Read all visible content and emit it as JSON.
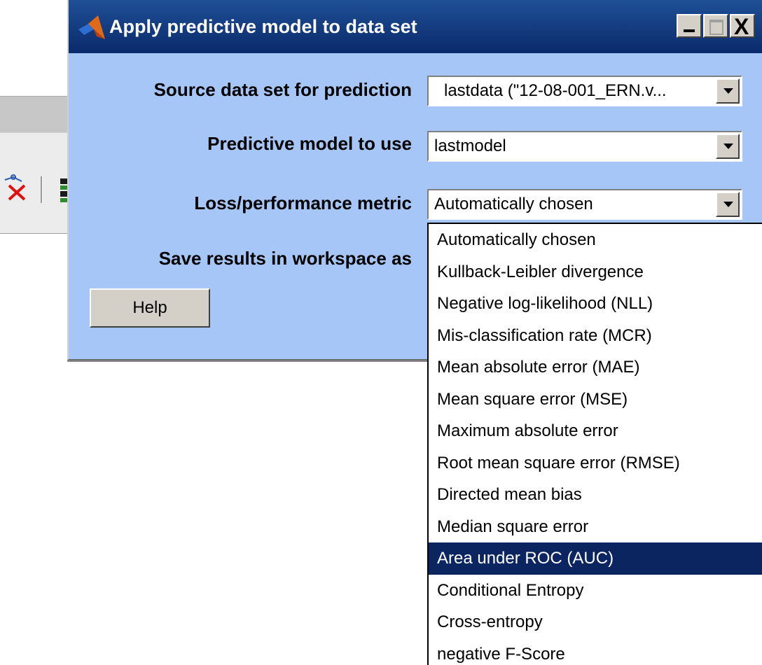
{
  "dialog": {
    "title": "Apply predictive model to data set",
    "window_buttons": {
      "minimize": "_",
      "maximize": "□",
      "close": "X"
    }
  },
  "fields": {
    "source": {
      "label": "Source data set for prediction",
      "value": "lastdata (\"12-08-001_ERN.v..."
    },
    "model": {
      "label": "Predictive model to use",
      "value": "lastmodel"
    },
    "metric": {
      "label": "Loss/performance metric",
      "value": "Automatically chosen"
    },
    "save": {
      "label": "Save results in workspace as"
    }
  },
  "help_button": "Help",
  "metric_options": [
    "Automatically chosen",
    "Kullback-Leibler divergence",
    "Negative log-likelihood (NLL)",
    "Mis-classification rate (MCR)",
    "Mean absolute error (MAE)",
    "Mean square error (MSE)",
    "Maximum absolute error",
    "Root mean square error (RMSE)",
    "Directed mean bias",
    "Median square error",
    "Area under ROC (AUC)",
    "Conditional Entropy",
    "Cross-entropy",
    "negative F-Score"
  ],
  "highlighted_option": "Area under ROC (AUC)",
  "colors": {
    "dialog_bg": "#a6c6f8",
    "titlebar": "#0a2a6b",
    "selection": "#0b2561"
  },
  "icons": [
    "matlab-logo-icon",
    "minimize-icon",
    "maximize-icon",
    "close-icon",
    "dropdown-arrow-icon",
    "plot-delete-icon",
    "toolbar-green-icon"
  ]
}
